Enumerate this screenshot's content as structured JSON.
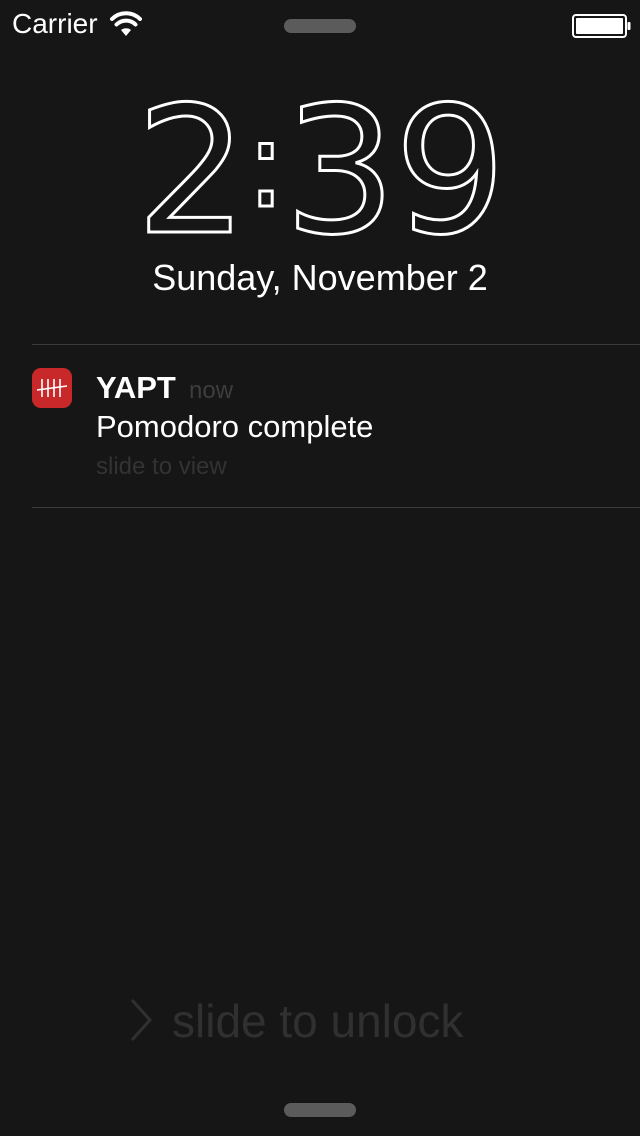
{
  "status_bar": {
    "carrier": "Carrier"
  },
  "lock_screen": {
    "clock": {
      "hours": "2",
      "separator": ":",
      "minutes": "39"
    },
    "date": "Sunday, November 2"
  },
  "notification": {
    "app_name": "YAPT",
    "time": "now",
    "message": "Pomodoro complete",
    "action_hint": "slide to view",
    "icon": "tally-marks-icon",
    "icon_color": "#c8282a"
  },
  "unlock": {
    "label": "slide to unlock",
    "icon": "chevron-right-icon"
  },
  "colors": {
    "background": "#161616",
    "text": "#ffffff",
    "dim_text": "#333333",
    "divider": "#3a3a3a"
  }
}
